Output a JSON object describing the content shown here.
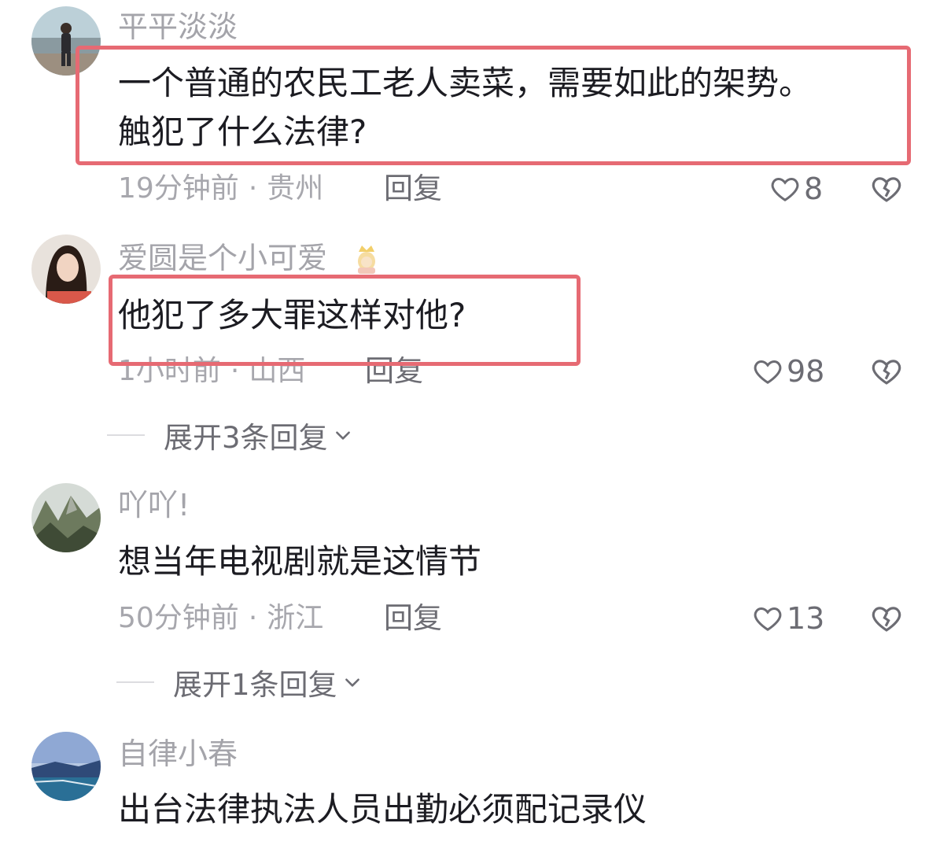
{
  "comments": [
    {
      "username": "平平淡淡",
      "content_lines": [
        "一个普通的农民工老人卖菜，需要如此的架势。",
        "触犯了什么法律?"
      ],
      "time": "19分钟前",
      "location": "贵州",
      "reply_label": "回复",
      "likes": "8"
    },
    {
      "username": "爱圆是个小可爱",
      "content_lines": [
        "他犯了多大罪这样对他?"
      ],
      "time": "1小时前",
      "location": "山西",
      "reply_label": "回复",
      "likes": "98",
      "expand_label": "展开3条回复"
    },
    {
      "username": "吖吖!",
      "content_lines": [
        "想当年电视剧就是这情节"
      ],
      "time": "50分钟前",
      "location": "浙江",
      "reply_label": "回复",
      "likes": "13",
      "expand_label": "展开1条回复"
    },
    {
      "username": "自律小春",
      "content_lines": [
        "出台法律执法人员出勤必须配记录仪"
      ]
    }
  ],
  "separator": "·",
  "colors": {
    "highlight_border": "#e66a73",
    "username": "#a4a4aa",
    "meta": "#a7a7ad",
    "reply": "#6c6c73"
  },
  "icons": [
    "heart-outline-icon",
    "broken-heart-icon",
    "chevron-down-icon",
    "princess-emoji-icon"
  ]
}
